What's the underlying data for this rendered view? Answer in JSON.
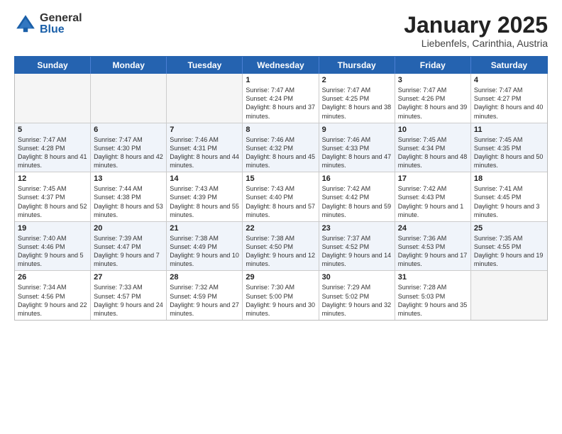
{
  "logo": {
    "general": "General",
    "blue": "Blue"
  },
  "title": "January 2025",
  "location": "Liebenfels, Carinthia, Austria",
  "days_of_week": [
    "Sunday",
    "Monday",
    "Tuesday",
    "Wednesday",
    "Thursday",
    "Friday",
    "Saturday"
  ],
  "weeks": [
    [
      {
        "day": "",
        "empty": true,
        "text": ""
      },
      {
        "day": "",
        "empty": true,
        "text": ""
      },
      {
        "day": "",
        "empty": true,
        "text": ""
      },
      {
        "day": "1",
        "empty": false,
        "text": "Sunrise: 7:47 AM\nSunset: 4:24 PM\nDaylight: 8 hours and 37 minutes."
      },
      {
        "day": "2",
        "empty": false,
        "text": "Sunrise: 7:47 AM\nSunset: 4:25 PM\nDaylight: 8 hours and 38 minutes."
      },
      {
        "day": "3",
        "empty": false,
        "text": "Sunrise: 7:47 AM\nSunset: 4:26 PM\nDaylight: 8 hours and 39 minutes."
      },
      {
        "day": "4",
        "empty": false,
        "text": "Sunrise: 7:47 AM\nSunset: 4:27 PM\nDaylight: 8 hours and 40 minutes."
      }
    ],
    [
      {
        "day": "5",
        "empty": false,
        "text": "Sunrise: 7:47 AM\nSunset: 4:28 PM\nDaylight: 8 hours and 41 minutes."
      },
      {
        "day": "6",
        "empty": false,
        "text": "Sunrise: 7:47 AM\nSunset: 4:30 PM\nDaylight: 8 hours and 42 minutes."
      },
      {
        "day": "7",
        "empty": false,
        "text": "Sunrise: 7:46 AM\nSunset: 4:31 PM\nDaylight: 8 hours and 44 minutes."
      },
      {
        "day": "8",
        "empty": false,
        "text": "Sunrise: 7:46 AM\nSunset: 4:32 PM\nDaylight: 8 hours and 45 minutes."
      },
      {
        "day": "9",
        "empty": false,
        "text": "Sunrise: 7:46 AM\nSunset: 4:33 PM\nDaylight: 8 hours and 47 minutes."
      },
      {
        "day": "10",
        "empty": false,
        "text": "Sunrise: 7:45 AM\nSunset: 4:34 PM\nDaylight: 8 hours and 48 minutes."
      },
      {
        "day": "11",
        "empty": false,
        "text": "Sunrise: 7:45 AM\nSunset: 4:35 PM\nDaylight: 8 hours and 50 minutes."
      }
    ],
    [
      {
        "day": "12",
        "empty": false,
        "text": "Sunrise: 7:45 AM\nSunset: 4:37 PM\nDaylight: 8 hours and 52 minutes."
      },
      {
        "day": "13",
        "empty": false,
        "text": "Sunrise: 7:44 AM\nSunset: 4:38 PM\nDaylight: 8 hours and 53 minutes."
      },
      {
        "day": "14",
        "empty": false,
        "text": "Sunrise: 7:43 AM\nSunset: 4:39 PM\nDaylight: 8 hours and 55 minutes."
      },
      {
        "day": "15",
        "empty": false,
        "text": "Sunrise: 7:43 AM\nSunset: 4:40 PM\nDaylight: 8 hours and 57 minutes."
      },
      {
        "day": "16",
        "empty": false,
        "text": "Sunrise: 7:42 AM\nSunset: 4:42 PM\nDaylight: 8 hours and 59 minutes."
      },
      {
        "day": "17",
        "empty": false,
        "text": "Sunrise: 7:42 AM\nSunset: 4:43 PM\nDaylight: 9 hours and 1 minute."
      },
      {
        "day": "18",
        "empty": false,
        "text": "Sunrise: 7:41 AM\nSunset: 4:45 PM\nDaylight: 9 hours and 3 minutes."
      }
    ],
    [
      {
        "day": "19",
        "empty": false,
        "text": "Sunrise: 7:40 AM\nSunset: 4:46 PM\nDaylight: 9 hours and 5 minutes."
      },
      {
        "day": "20",
        "empty": false,
        "text": "Sunrise: 7:39 AM\nSunset: 4:47 PM\nDaylight: 9 hours and 7 minutes."
      },
      {
        "day": "21",
        "empty": false,
        "text": "Sunrise: 7:38 AM\nSunset: 4:49 PM\nDaylight: 9 hours and 10 minutes."
      },
      {
        "day": "22",
        "empty": false,
        "text": "Sunrise: 7:38 AM\nSunset: 4:50 PM\nDaylight: 9 hours and 12 minutes."
      },
      {
        "day": "23",
        "empty": false,
        "text": "Sunrise: 7:37 AM\nSunset: 4:52 PM\nDaylight: 9 hours and 14 minutes."
      },
      {
        "day": "24",
        "empty": false,
        "text": "Sunrise: 7:36 AM\nSunset: 4:53 PM\nDaylight: 9 hours and 17 minutes."
      },
      {
        "day": "25",
        "empty": false,
        "text": "Sunrise: 7:35 AM\nSunset: 4:55 PM\nDaylight: 9 hours and 19 minutes."
      }
    ],
    [
      {
        "day": "26",
        "empty": false,
        "text": "Sunrise: 7:34 AM\nSunset: 4:56 PM\nDaylight: 9 hours and 22 minutes."
      },
      {
        "day": "27",
        "empty": false,
        "text": "Sunrise: 7:33 AM\nSunset: 4:57 PM\nDaylight: 9 hours and 24 minutes."
      },
      {
        "day": "28",
        "empty": false,
        "text": "Sunrise: 7:32 AM\nSunset: 4:59 PM\nDaylight: 9 hours and 27 minutes."
      },
      {
        "day": "29",
        "empty": false,
        "text": "Sunrise: 7:30 AM\nSunset: 5:00 PM\nDaylight: 9 hours and 30 minutes."
      },
      {
        "day": "30",
        "empty": false,
        "text": "Sunrise: 7:29 AM\nSunset: 5:02 PM\nDaylight: 9 hours and 32 minutes."
      },
      {
        "day": "31",
        "empty": false,
        "text": "Sunrise: 7:28 AM\nSunset: 5:03 PM\nDaylight: 9 hours and 35 minutes."
      },
      {
        "day": "",
        "empty": true,
        "text": ""
      }
    ]
  ]
}
